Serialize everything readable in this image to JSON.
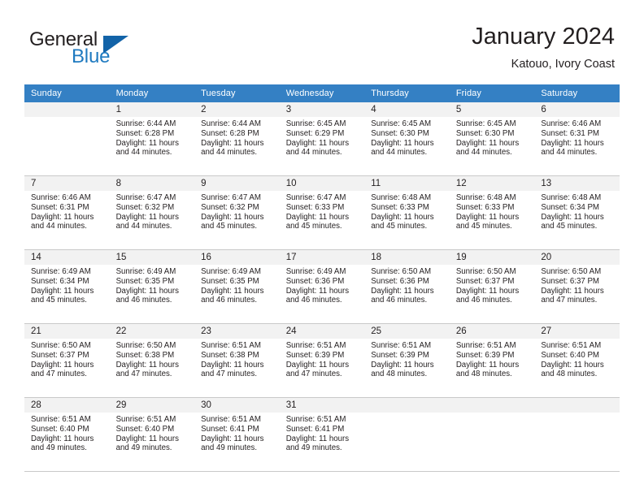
{
  "brand": {
    "word_top": "General",
    "word_bottom": "Blue",
    "triangle_color": "#1263a8",
    "blue_color": "#1f7ac0"
  },
  "header": {
    "title": "January 2024",
    "subtitle": "Katouo, Ivory Coast"
  },
  "calendar": {
    "header_bg": "#3480c4",
    "weekday_headers": [
      "Sunday",
      "Monday",
      "Tuesday",
      "Wednesday",
      "Thursday",
      "Friday",
      "Saturday"
    ],
    "weeks": [
      [
        {
          "day": "",
          "sunrise": "",
          "sunset": "",
          "daylight_line1": "",
          "daylight_line2": ""
        },
        {
          "day": "1",
          "sunrise": "Sunrise: 6:44 AM",
          "sunset": "Sunset: 6:28 PM",
          "daylight_line1": "Daylight: 11 hours",
          "daylight_line2": "and 44 minutes."
        },
        {
          "day": "2",
          "sunrise": "Sunrise: 6:44 AM",
          "sunset": "Sunset: 6:28 PM",
          "daylight_line1": "Daylight: 11 hours",
          "daylight_line2": "and 44 minutes."
        },
        {
          "day": "3",
          "sunrise": "Sunrise: 6:45 AM",
          "sunset": "Sunset: 6:29 PM",
          "daylight_line1": "Daylight: 11 hours",
          "daylight_line2": "and 44 minutes."
        },
        {
          "day": "4",
          "sunrise": "Sunrise: 6:45 AM",
          "sunset": "Sunset: 6:30 PM",
          "daylight_line1": "Daylight: 11 hours",
          "daylight_line2": "and 44 minutes."
        },
        {
          "day": "5",
          "sunrise": "Sunrise: 6:45 AM",
          "sunset": "Sunset: 6:30 PM",
          "daylight_line1": "Daylight: 11 hours",
          "daylight_line2": "and 44 minutes."
        },
        {
          "day": "6",
          "sunrise": "Sunrise: 6:46 AM",
          "sunset": "Sunset: 6:31 PM",
          "daylight_line1": "Daylight: 11 hours",
          "daylight_line2": "and 44 minutes."
        }
      ],
      [
        {
          "day": "7",
          "sunrise": "Sunrise: 6:46 AM",
          "sunset": "Sunset: 6:31 PM",
          "daylight_line1": "Daylight: 11 hours",
          "daylight_line2": "and 44 minutes."
        },
        {
          "day": "8",
          "sunrise": "Sunrise: 6:47 AM",
          "sunset": "Sunset: 6:32 PM",
          "daylight_line1": "Daylight: 11 hours",
          "daylight_line2": "and 44 minutes."
        },
        {
          "day": "9",
          "sunrise": "Sunrise: 6:47 AM",
          "sunset": "Sunset: 6:32 PM",
          "daylight_line1": "Daylight: 11 hours",
          "daylight_line2": "and 45 minutes."
        },
        {
          "day": "10",
          "sunrise": "Sunrise: 6:47 AM",
          "sunset": "Sunset: 6:33 PM",
          "daylight_line1": "Daylight: 11 hours",
          "daylight_line2": "and 45 minutes."
        },
        {
          "day": "11",
          "sunrise": "Sunrise: 6:48 AM",
          "sunset": "Sunset: 6:33 PM",
          "daylight_line1": "Daylight: 11 hours",
          "daylight_line2": "and 45 minutes."
        },
        {
          "day": "12",
          "sunrise": "Sunrise: 6:48 AM",
          "sunset": "Sunset: 6:33 PM",
          "daylight_line1": "Daylight: 11 hours",
          "daylight_line2": "and 45 minutes."
        },
        {
          "day": "13",
          "sunrise": "Sunrise: 6:48 AM",
          "sunset": "Sunset: 6:34 PM",
          "daylight_line1": "Daylight: 11 hours",
          "daylight_line2": "and 45 minutes."
        }
      ],
      [
        {
          "day": "14",
          "sunrise": "Sunrise: 6:49 AM",
          "sunset": "Sunset: 6:34 PM",
          "daylight_line1": "Daylight: 11 hours",
          "daylight_line2": "and 45 minutes."
        },
        {
          "day": "15",
          "sunrise": "Sunrise: 6:49 AM",
          "sunset": "Sunset: 6:35 PM",
          "daylight_line1": "Daylight: 11 hours",
          "daylight_line2": "and 46 minutes."
        },
        {
          "day": "16",
          "sunrise": "Sunrise: 6:49 AM",
          "sunset": "Sunset: 6:35 PM",
          "daylight_line1": "Daylight: 11 hours",
          "daylight_line2": "and 46 minutes."
        },
        {
          "day": "17",
          "sunrise": "Sunrise: 6:49 AM",
          "sunset": "Sunset: 6:36 PM",
          "daylight_line1": "Daylight: 11 hours",
          "daylight_line2": "and 46 minutes."
        },
        {
          "day": "18",
          "sunrise": "Sunrise: 6:50 AM",
          "sunset": "Sunset: 6:36 PM",
          "daylight_line1": "Daylight: 11 hours",
          "daylight_line2": "and 46 minutes."
        },
        {
          "day": "19",
          "sunrise": "Sunrise: 6:50 AM",
          "sunset": "Sunset: 6:37 PM",
          "daylight_line1": "Daylight: 11 hours",
          "daylight_line2": "and 46 minutes."
        },
        {
          "day": "20",
          "sunrise": "Sunrise: 6:50 AM",
          "sunset": "Sunset: 6:37 PM",
          "daylight_line1": "Daylight: 11 hours",
          "daylight_line2": "and 47 minutes."
        }
      ],
      [
        {
          "day": "21",
          "sunrise": "Sunrise: 6:50 AM",
          "sunset": "Sunset: 6:37 PM",
          "daylight_line1": "Daylight: 11 hours",
          "daylight_line2": "and 47 minutes."
        },
        {
          "day": "22",
          "sunrise": "Sunrise: 6:50 AM",
          "sunset": "Sunset: 6:38 PM",
          "daylight_line1": "Daylight: 11 hours",
          "daylight_line2": "and 47 minutes."
        },
        {
          "day": "23",
          "sunrise": "Sunrise: 6:51 AM",
          "sunset": "Sunset: 6:38 PM",
          "daylight_line1": "Daylight: 11 hours",
          "daylight_line2": "and 47 minutes."
        },
        {
          "day": "24",
          "sunrise": "Sunrise: 6:51 AM",
          "sunset": "Sunset: 6:39 PM",
          "daylight_line1": "Daylight: 11 hours",
          "daylight_line2": "and 47 minutes."
        },
        {
          "day": "25",
          "sunrise": "Sunrise: 6:51 AM",
          "sunset": "Sunset: 6:39 PM",
          "daylight_line1": "Daylight: 11 hours",
          "daylight_line2": "and 48 minutes."
        },
        {
          "day": "26",
          "sunrise": "Sunrise: 6:51 AM",
          "sunset": "Sunset: 6:39 PM",
          "daylight_line1": "Daylight: 11 hours",
          "daylight_line2": "and 48 minutes."
        },
        {
          "day": "27",
          "sunrise": "Sunrise: 6:51 AM",
          "sunset": "Sunset: 6:40 PM",
          "daylight_line1": "Daylight: 11 hours",
          "daylight_line2": "and 48 minutes."
        }
      ],
      [
        {
          "day": "28",
          "sunrise": "Sunrise: 6:51 AM",
          "sunset": "Sunset: 6:40 PM",
          "daylight_line1": "Daylight: 11 hours",
          "daylight_line2": "and 49 minutes."
        },
        {
          "day": "29",
          "sunrise": "Sunrise: 6:51 AM",
          "sunset": "Sunset: 6:40 PM",
          "daylight_line1": "Daylight: 11 hours",
          "daylight_line2": "and 49 minutes."
        },
        {
          "day": "30",
          "sunrise": "Sunrise: 6:51 AM",
          "sunset": "Sunset: 6:41 PM",
          "daylight_line1": "Daylight: 11 hours",
          "daylight_line2": "and 49 minutes."
        },
        {
          "day": "31",
          "sunrise": "Sunrise: 6:51 AM",
          "sunset": "Sunset: 6:41 PM",
          "daylight_line1": "Daylight: 11 hours",
          "daylight_line2": "and 49 minutes."
        },
        {
          "day": "",
          "sunrise": "",
          "sunset": "",
          "daylight_line1": "",
          "daylight_line2": ""
        },
        {
          "day": "",
          "sunrise": "",
          "sunset": "",
          "daylight_line1": "",
          "daylight_line2": ""
        },
        {
          "day": "",
          "sunrise": "",
          "sunset": "",
          "daylight_line1": "",
          "daylight_line2": ""
        }
      ]
    ]
  }
}
